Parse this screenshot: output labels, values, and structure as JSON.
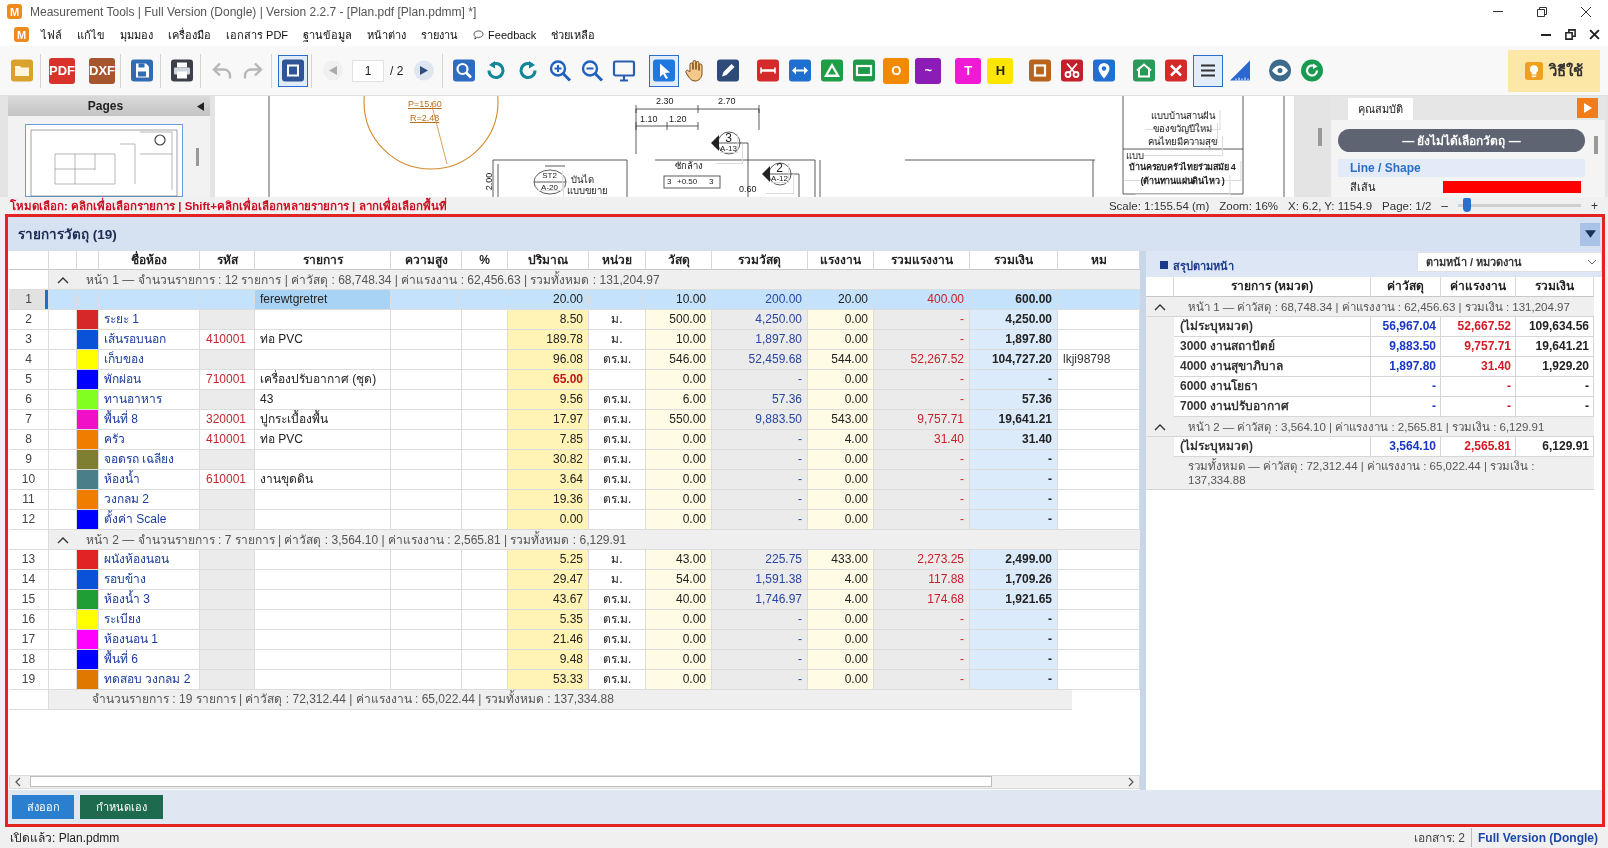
{
  "window": {
    "logo": "M",
    "title": "Measurement Tools | Full Version (Dongle) | Version 2.2.7 - [Plan.pdf [Plan.pdmm] *]"
  },
  "menu": {
    "logo": "M",
    "items": [
      {
        "label": "ไฟล์",
        "kind": "text"
      },
      {
        "label": "แก้ไข",
        "kind": "text"
      },
      {
        "label": "มุมมอง",
        "kind": "text"
      },
      {
        "label": "เครื่องมือ",
        "kind": "text"
      },
      {
        "label": "เอกสาร PDF",
        "kind": "text"
      },
      {
        "label": "ฐานข้อมูล",
        "kind": "text"
      },
      {
        "label": "หน้าต่าง",
        "kind": "text"
      },
      {
        "label": "รายงาน",
        "kind": "text"
      },
      {
        "label": "Feedback",
        "kind": "feedback"
      },
      {
        "label": "ช่วยเหลือ",
        "kind": "text"
      }
    ]
  },
  "toolbar": {
    "groups_left": [
      {
        "tools": [
          {
            "kind": "icon",
            "selected": false,
            "disabled": false
          }
        ]
      },
      {
        "tools": [
          {
            "kind": "tile",
            "label": "PDF",
            "color": "#d8322b",
            "selected": false,
            "disabled": false
          },
          {
            "kind": "tile",
            "label": "DXF",
            "color": "#a5562f",
            "selected": false,
            "disabled": false
          }
        ]
      },
      {
        "tools": [
          {
            "kind": "icon",
            "selected": false,
            "disabled": false
          }
        ]
      },
      {
        "tools": [
          {
            "kind": "icon",
            "selected": false,
            "disabled": false
          }
        ]
      },
      {
        "tools": [
          {
            "kind": "icon",
            "selected": false,
            "disabled": true
          },
          {
            "kind": "icon",
            "selected": false,
            "disabled": true
          }
        ]
      },
      {
        "tools": [
          {
            "kind": "icon",
            "selected": true,
            "disabled": false
          }
        ]
      }
    ],
    "page": {
      "previous": {
        "disabled": true
      },
      "field": {
        "value": "1"
      },
      "total": "/ 2",
      "next": {
        "disabled": false
      }
    },
    "groups_right": [
      {
        "tools": [
          {
            "kind": "icon",
            "selected": false,
            "disabled": false
          },
          {
            "kind": "icon",
            "selected": false,
            "disabled": false
          },
          {
            "kind": "icon",
            "selected": false,
            "disabled": false
          },
          {
            "kind": "icon",
            "selected": false,
            "disabled": false
          },
          {
            "kind": "icon",
            "selected": false,
            "disabled": false
          },
          {
            "kind": "icon",
            "selected": false,
            "disabled": false
          }
        ]
      },
      {
        "tools": [
          {
            "kind": "icon",
            "selected": true,
            "disabled": false
          },
          {
            "kind": "icon",
            "selected": false,
            "disabled": false
          },
          {
            "kind": "icon",
            "selected": false,
            "disabled": false
          }
        ]
      },
      {
        "tools": [
          {
            "kind": "icon",
            "selected": false,
            "disabled": false
          },
          {
            "kind": "icon",
            "selected": false,
            "disabled": false
          },
          {
            "kind": "icon",
            "selected": false,
            "disabled": false
          },
          {
            "kind": "icon",
            "selected": false,
            "disabled": false
          },
          {
            "kind": "tile",
            "label": "O",
            "color": "#f28a00",
            "selected": false,
            "disabled": false
          },
          {
            "kind": "tile",
            "label": "~",
            "color": "#8c1cb6",
            "selected": false,
            "disabled": false
          }
        ]
      },
      {
        "tools": [
          {
            "kind": "tile",
            "label": "T",
            "color": "#f01ad4",
            "selected": false,
            "disabled": false
          },
          {
            "kind": "tile",
            "label": "H",
            "color": "#ffe600",
            "selected": false,
            "disabled": false
          }
        ]
      },
      {
        "tools": [
          {
            "kind": "icon",
            "selected": false,
            "disabled": false
          },
          {
            "kind": "icon",
            "selected": false,
            "disabled": false
          },
          {
            "kind": "icon",
            "selected": false,
            "disabled": false
          }
        ]
      },
      {
        "tools": [
          {
            "kind": "icon",
            "selected": false,
            "disabled": false
          },
          {
            "kind": "icon",
            "selected": false,
            "disabled": false
          },
          {
            "kind": "icon",
            "selected": true,
            "disabled": false
          },
          {
            "kind": "icon",
            "selected": false,
            "disabled": false
          }
        ]
      },
      {
        "tools": [
          {
            "kind": "icon",
            "selected": false,
            "disabled": false
          },
          {
            "kind": "icon",
            "selected": false,
            "disabled": false
          }
        ]
      }
    ],
    "help_button": "วิธีใช้"
  },
  "pages_pane": {
    "title": "Pages"
  },
  "drawing": {
    "labels": [
      "P=15.60",
      "R=2.48",
      "2.30",
      "2.70",
      "1.10",
      "1.20",
      "3",
      "A-13",
      "2",
      "A-12",
      "ST2",
      "A-20",
      "บันได",
      "แบบขยาย",
      "ซักล้าง",
      "3",
      "+0.50",
      "3",
      "2.00",
      "0.60",
      "แบบบ้านสานฝัน",
      "ของขวัญปีใหม่",
      "คนไทยมีความสุข",
      "แบบ",
      "บ้านครอบครัวไทยร่วมสมัย 4",
      "(ต้านทานแผ่นดินไหว )"
    ]
  },
  "properties": {
    "tab": "คุณสมบัติ",
    "selection": "— ยังไม่ได้เลือกวัตถุ —",
    "section": "Line / Shape",
    "fields": [
      {
        "label": "สีเส้น",
        "color": "#ff0000"
      }
    ]
  },
  "status_line": {
    "hint": "โหมดเลือก: คลิกเพื่อเลือกรายการ | Shift+คลิกเพื่อเลือกหลายรายการ | ลากเพื่อเลือกพื้นที่",
    "scale": "Scale: 1:155.54 (m)",
    "zoom": "Zoom: 16%",
    "position": "X: 6.2, Y: 1154.9",
    "page": "Page: 1/2",
    "zoom_slider": {
      "minus": "–",
      "plus": "+",
      "level": 0.07
    }
  },
  "panel": {
    "title": "รายการวัตถุ (19)",
    "table": {
      "columns": [
        "ชื่อห้อง",
        "รหัส",
        "รายการ",
        "ความสูง",
        "%",
        "ปริมาณ",
        "หน่วย",
        "วัสดุ",
        "รวมวัสดุ",
        "แรงงาน",
        "รวมแรงงาน",
        "รวมเงิน",
        "หม"
      ],
      "groups": [
        {
          "summary": "หน้า 1 — จำนวนรายการ : 12 รายการ | ค่าวัสดุ : 68,748.34 | ค่าแรงงาน : 62,456.63 | รวมทั้งหมด : 131,204.97",
          "expanded": true,
          "rows": [
            {
              "number": "1",
              "selected": true,
              "qty_edited": false,
              "item": "ferewtgretret",
              "qty": "20.00",
              "material": "10.00",
              "material_total": "200.00",
              "labor": "20.00",
              "labor_total": "400.00",
              "total": "600.00"
            },
            {
              "number": "2",
              "selected": false,
              "qty_edited": false,
              "color": "#d62828",
              "name": "ระยะ 1",
              "qty": "8.50",
              "unit": "ม.",
              "material": "500.00",
              "material_total": "4,250.00",
              "labor": "0.00",
              "labor_total": "-",
              "total": "4,250.00"
            },
            {
              "number": "3",
              "selected": false,
              "qty_edited": false,
              "color": "#0a52d8",
              "name": "เส้นรอบนอก",
              "code": "410001",
              "item": "ท่อ PVC",
              "qty": "189.78",
              "unit": "ม.",
              "material": "10.00",
              "material_total": "1,897.80",
              "labor": "0.00",
              "labor_total": "-",
              "total": "1,897.80"
            },
            {
              "number": "4",
              "selected": false,
              "qty_edited": false,
              "color": "#ffff00",
              "name": "เก็บของ",
              "qty": "96.08",
              "unit": "ตร.ม.",
              "material": "546.00",
              "material_total": "52,459.68",
              "labor": "544.00",
              "labor_total": "52,267.52",
              "total": "104,727.20",
              "column_13": "lkji98798"
            },
            {
              "number": "5",
              "selected": false,
              "qty_edited": true,
              "color": "#0000ff",
              "name": "พักผ่อน",
              "code": "710001",
              "item": "เครื่องปรับอากาศ (ชุด)",
              "qty": "65.00",
              "material": "0.00",
              "material_total": "-",
              "labor": "0.00",
              "labor_total": "-",
              "total": "-"
            },
            {
              "number": "6",
              "selected": false,
              "qty_edited": false,
              "color": "#80ff20",
              "name": "ทานอาหาร",
              "item": "43",
              "qty": "9.56",
              "unit": "ตร.ม.",
              "material": "6.00",
              "material_total": "57.36",
              "labor": "0.00",
              "labor_total": "-",
              "total": "57.36"
            },
            {
              "number": "7",
              "selected": false,
              "qty_edited": false,
              "color": "#f010c8",
              "name": "พื้นที่ 8",
              "code": "320001",
              "item": "ปูกระเบื้องพื้น",
              "qty": "17.97",
              "unit": "ตร.ม.",
              "material": "550.00",
              "material_total": "9,883.50",
              "labor": "543.00",
              "labor_total": "9,757.71",
              "total": "19,641.21"
            },
            {
              "number": "8",
              "selected": false,
              "qty_edited": false,
              "color": "#f07c00",
              "name": "ครัว",
              "code": "410001",
              "item": "ท่อ PVC",
              "qty": "7.85",
              "unit": "ตร.ม.",
              "material": "0.00",
              "material_total": "-",
              "labor": "4.00",
              "labor_total": "31.40",
              "total": "31.40"
            },
            {
              "number": "9",
              "selected": false,
              "qty_edited": false,
              "color": "#7f7f32",
              "name": "จอดรถ เฉลียง",
              "qty": "30.82",
              "unit": "ตร.ม.",
              "material": "0.00",
              "material_total": "-",
              "labor": "0.00",
              "labor_total": "-",
              "total": "-"
            },
            {
              "number": "10",
              "selected": false,
              "qty_edited": false,
              "color": "#4a7f88",
              "name": "ห้องน้ำ",
              "code": "610001",
              "item": "งานขุดดิน",
              "qty": "3.64",
              "unit": "ตร.ม.",
              "material": "0.00",
              "material_total": "-",
              "labor": "0.00",
              "labor_total": "-",
              "total": "-"
            },
            {
              "number": "11",
              "selected": false,
              "qty_edited": false,
              "color": "#f07c00",
              "name": "วงกลม 2",
              "qty": "19.36",
              "unit": "ตร.ม.",
              "material": "0.00",
              "material_total": "-",
              "labor": "0.00",
              "labor_total": "-",
              "total": "-"
            },
            {
              "number": "12",
              "selected": false,
              "qty_edited": false,
              "color": "#0000ff",
              "name": "ตั้งค่า Scale",
              "qty": "0.00",
              "material": "0.00",
              "material_total": "-",
              "labor": "0.00",
              "labor_total": "-",
              "total": "-"
            }
          ]
        },
        {
          "summary": "หน้า 2 — จำนวนรายการ : 7 รายการ | ค่าวัสดุ : 3,564.10 | ค่าแรงงาน : 2,565.81 | รวมทั้งหมด : 6,129.91",
          "expanded": true,
          "rows": [
            {
              "number": "13",
              "selected": false,
              "qty_edited": false,
              "color": "#e02424",
              "name": "ผนังห้องนอน",
              "qty": "5.25",
              "unit": "ม.",
              "material": "43.00",
              "material_total": "225.75",
              "labor": "433.00",
              "labor_total": "2,273.25",
              "total": "2,499.00"
            },
            {
              "number": "14",
              "selected": false,
              "qty_edited": false,
              "color": "#0a52d8",
              "name": "รอบข้าง",
              "qty": "29.47",
              "unit": "ม.",
              "material": "54.00",
              "material_total": "1,591.38",
              "labor": "4.00",
              "labor_total": "117.88",
              "total": "1,709.26"
            },
            {
              "number": "15",
              "selected": false,
              "qty_edited": false,
              "color": "#1f9e34",
              "name": "ห้องน้ำ 3",
              "qty": "43.67",
              "unit": "ตร.ม.",
              "material": "40.00",
              "material_total": "1,746.97",
              "labor": "4.00",
              "labor_total": "174.68",
              "total": "1,921.65"
            },
            {
              "number": "16",
              "selected": false,
              "qty_edited": false,
              "color": "#ffff00",
              "name": "ระเบียง",
              "qty": "5.35",
              "unit": "ตร.ม.",
              "material": "0.00",
              "material_total": "-",
              "labor": "0.00",
              "labor_total": "-",
              "total": "-"
            },
            {
              "number": "17",
              "selected": false,
              "qty_edited": false,
              "color": "#ff00ff",
              "name": "ห้องนอน 1",
              "qty": "21.46",
              "unit": "ตร.ม.",
              "material": "0.00",
              "material_total": "-",
              "labor": "0.00",
              "labor_total": "-",
              "total": "-"
            },
            {
              "number": "18",
              "selected": false,
              "qty_edited": false,
              "color": "#0000ff",
              "name": "พื้นที่ 6",
              "qty": "9.48",
              "unit": "ตร.ม.",
              "material": "0.00",
              "material_total": "-",
              "labor": "0.00",
              "labor_total": "-",
              "total": "-"
            },
            {
              "number": "19",
              "selected": false,
              "qty_edited": false,
              "color": "#e07800",
              "name": "ทดสอบ วงกลม 2",
              "qty": "53.33",
              "unit": "ตร.ม.",
              "material": "0.00",
              "material_total": "-",
              "labor": "0.00",
              "labor_total": "-",
              "total": "-"
            }
          ]
        }
      ],
      "footer": "จำนวนรายการ : 19 รายการ | ค่าวัสดุ : 72,312.44 | ค่าแรงงาน : 65,022.44 | รวมทั้งหมด : 137,334.88"
    },
    "summary": {
      "title": "สรุปตามหน้า",
      "view": "ตามหน้า / หมวดงาน",
      "columns": [
        "รายการ (หมวด)",
        "ค่าวัสดุ",
        "ค่าแรงงาน",
        "รวมเงิน"
      ],
      "groups": [
        {
          "summary": "หน้า 1 — ค่าวัสดุ : 68,748.34 | ค่าแรงงาน : 62,456.63 | รวมเงิน : 131,204.97",
          "expanded": true,
          "rows": [
            {
              "category": "(ไม่ระบุหมวด)",
              "material": "56,967.04",
              "labor": "52,667.52",
              "total": "109,634.56"
            },
            {
              "category": "3000 งานสถาปัตย์",
              "material": "9,883.50",
              "labor": "9,757.71",
              "total": "19,641.21"
            },
            {
              "category": "4000 งานสุขาภิบาล",
              "material": "1,897.80",
              "labor": "31.40",
              "total": "1,929.20"
            },
            {
              "category": "6000 งานโยธา",
              "material": "-",
              "labor": "-",
              "total": "-"
            },
            {
              "category": "7000 งานปรับอากาศ",
              "material": "-",
              "labor": "-",
              "total": "-"
            }
          ]
        },
        {
          "summary": "หน้า 2 — ค่าวัสดุ : 3,564.10 | ค่าแรงงาน : 2,565.81 | รวมเงิน : 6,129.91",
          "expanded": true,
          "rows": [
            {
              "category": "(ไม่ระบุหมวด)",
              "material": "3,564.10",
              "labor": "2,565.81",
              "total": "6,129.91"
            }
          ]
        }
      ],
      "footer": "รวมทั้งหมด — ค่าวัสดุ : 72,312.44 | ค่าแรงงาน : 65,022.44 | รวมเงิน : 137,334.88"
    },
    "buttons": [
      {
        "label": "ส่งออก",
        "color": "#2a7fcf"
      },
      {
        "label": "กำหนดเอง",
        "color": "#1e6a4e"
      }
    ]
  },
  "status_bar": {
    "file": "เปิดแล้ว: Plan.pdmm",
    "documents": "เอกสาร: 2",
    "license": "Full Version (Dongle)"
  }
}
